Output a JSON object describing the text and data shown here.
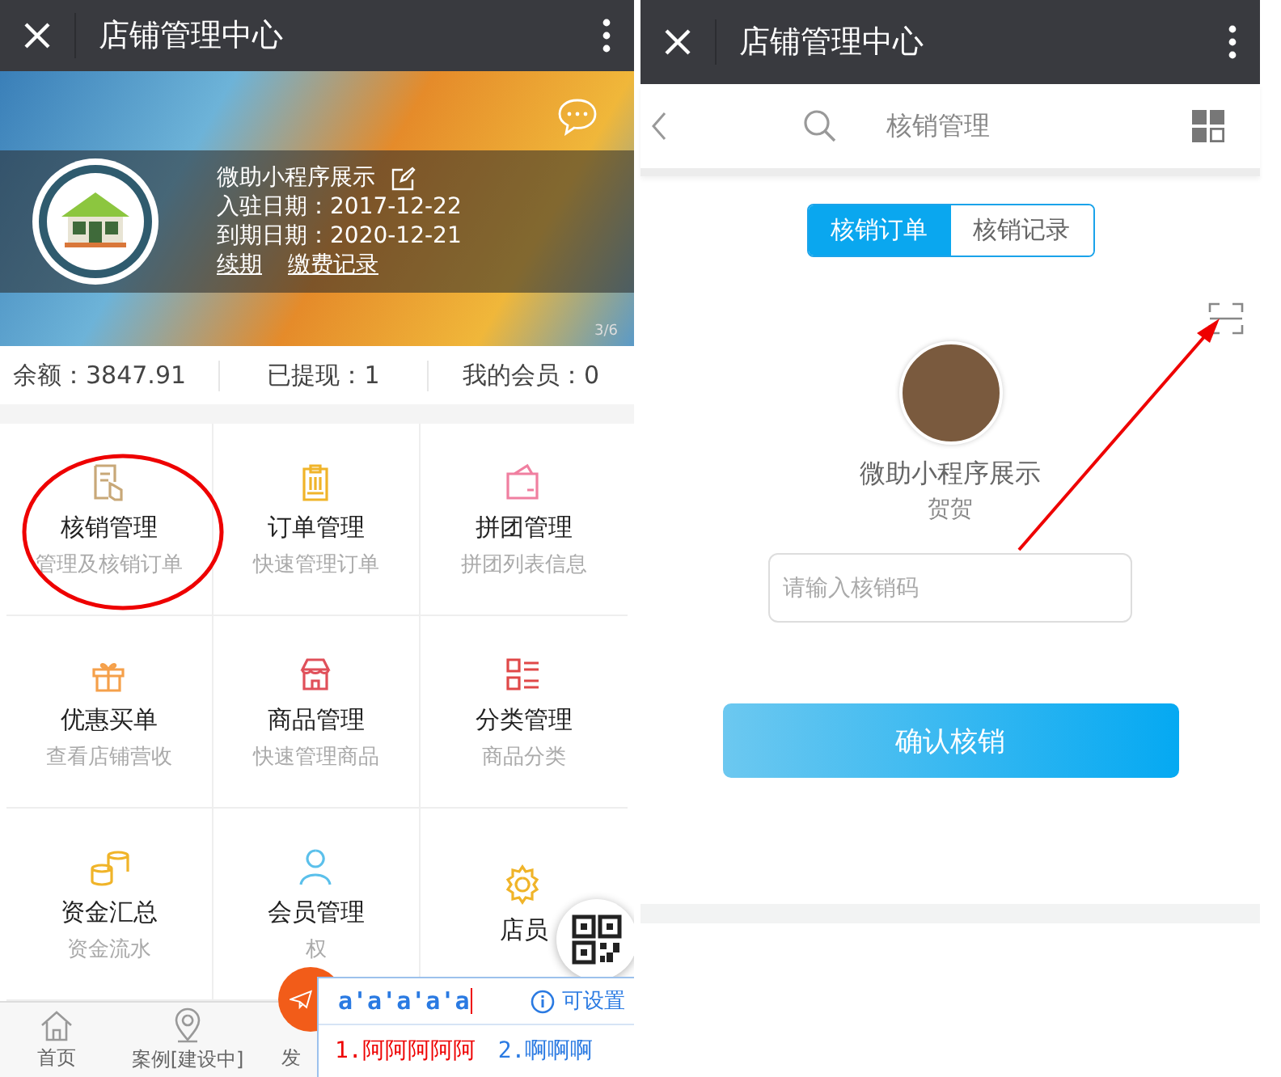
{
  "left_screen": {
    "title_bar": {
      "title": "店铺管理中心"
    },
    "banner": {
      "shop_name": "微助小程序展示",
      "join_date": "入驻日期：2017-12-22",
      "expire_date": "到期日期：2020-12-21",
      "links": [
        "续期",
        "缴费记录"
      ],
      "page_indicator": "3/6"
    },
    "stats": [
      "余额：3847.91",
      "已提现：1",
      "我的会员：0"
    ],
    "menu": [
      {
        "title": "核销管理",
        "subtitle": "管理及核销订单",
        "color": "#c8a878"
      },
      {
        "title": "订单管理",
        "subtitle": "快速管理订单",
        "color": "#f0b429"
      },
      {
        "title": "拼团管理",
        "subtitle": "拼团列表信息",
        "color": "#f07fa0"
      },
      {
        "title": "优惠买单",
        "subtitle": "查看店铺营收",
        "color": "#f5a04a"
      },
      {
        "title": "商品管理",
        "subtitle": "快速管理商品",
        "color": "#e0505a"
      },
      {
        "title": "分类管理",
        "subtitle": "商品分类",
        "color": "#e04848"
      },
      {
        "title": "资金汇总",
        "subtitle": "资金流水",
        "color": "#f0b429"
      },
      {
        "title": "会员管理",
        "subtitle": "权",
        "color": "#5bc0eb"
      },
      {
        "title": "店员",
        "color": "#f0b429"
      }
    ],
    "tab_bar": [
      "首页",
      "案例[建设中]",
      "发"
    ],
    "ime_popup": {
      "input": "a'a'a'a'a",
      "hint": "可设置",
      "candidates": [
        "1.阿阿阿阿阿",
        "2.啊啊啊"
      ]
    }
  },
  "right_screen": {
    "title_bar": {
      "title": "店铺管理中心"
    },
    "nav_bar": {
      "title": "核销管理"
    },
    "tabs": [
      {
        "label": "核销订单",
        "selected": true
      },
      {
        "label": "核销记录",
        "selected": false
      }
    ],
    "profile": {
      "name": "微助小程序展示",
      "subtitle": "贺贺"
    },
    "code_field": {
      "placeholder": "请输入核销码"
    },
    "confirm_button": "确认核销"
  }
}
